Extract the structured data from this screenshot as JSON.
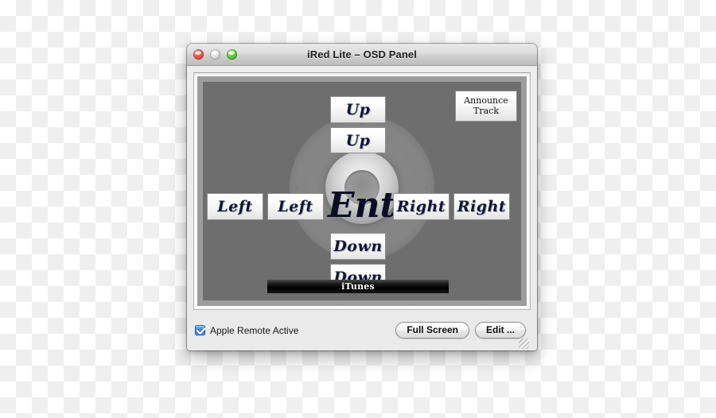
{
  "window": {
    "title": "iRed Lite – OSD Panel",
    "controls": {
      "close_label": "close-button",
      "minimize_label": "minimize-button",
      "zoom_label": "zoom-button"
    }
  },
  "osd": {
    "background_color": "#6e6e6e",
    "frame_color": "#9d9d9d",
    "buttons": [
      {
        "id": "up-1",
        "label": "Up"
      },
      {
        "id": "up-2",
        "label": "Up"
      },
      {
        "id": "left-1",
        "label": "Left"
      },
      {
        "id": "left-2",
        "label": "Left"
      },
      {
        "id": "enter",
        "label": "Enter"
      },
      {
        "id": "right-1",
        "label": "Right"
      },
      {
        "id": "right-2",
        "label": "Right"
      },
      {
        "id": "down-1",
        "label": "Down"
      },
      {
        "id": "down-2",
        "label": "Down"
      }
    ],
    "announce": {
      "line1": "Announce",
      "line2": "Track"
    },
    "status_bar": {
      "label": "iTunes"
    },
    "wheel_marks": {
      "up": "+",
      "down": "–",
      "left": "«",
      "right": "»"
    }
  },
  "footer": {
    "checkbox": {
      "label": "Apple Remote Active",
      "checked": true,
      "accent_color": "#3f84dd"
    },
    "buttons": {
      "full_screen": "Full Screen",
      "edit": "Edit ..."
    }
  }
}
